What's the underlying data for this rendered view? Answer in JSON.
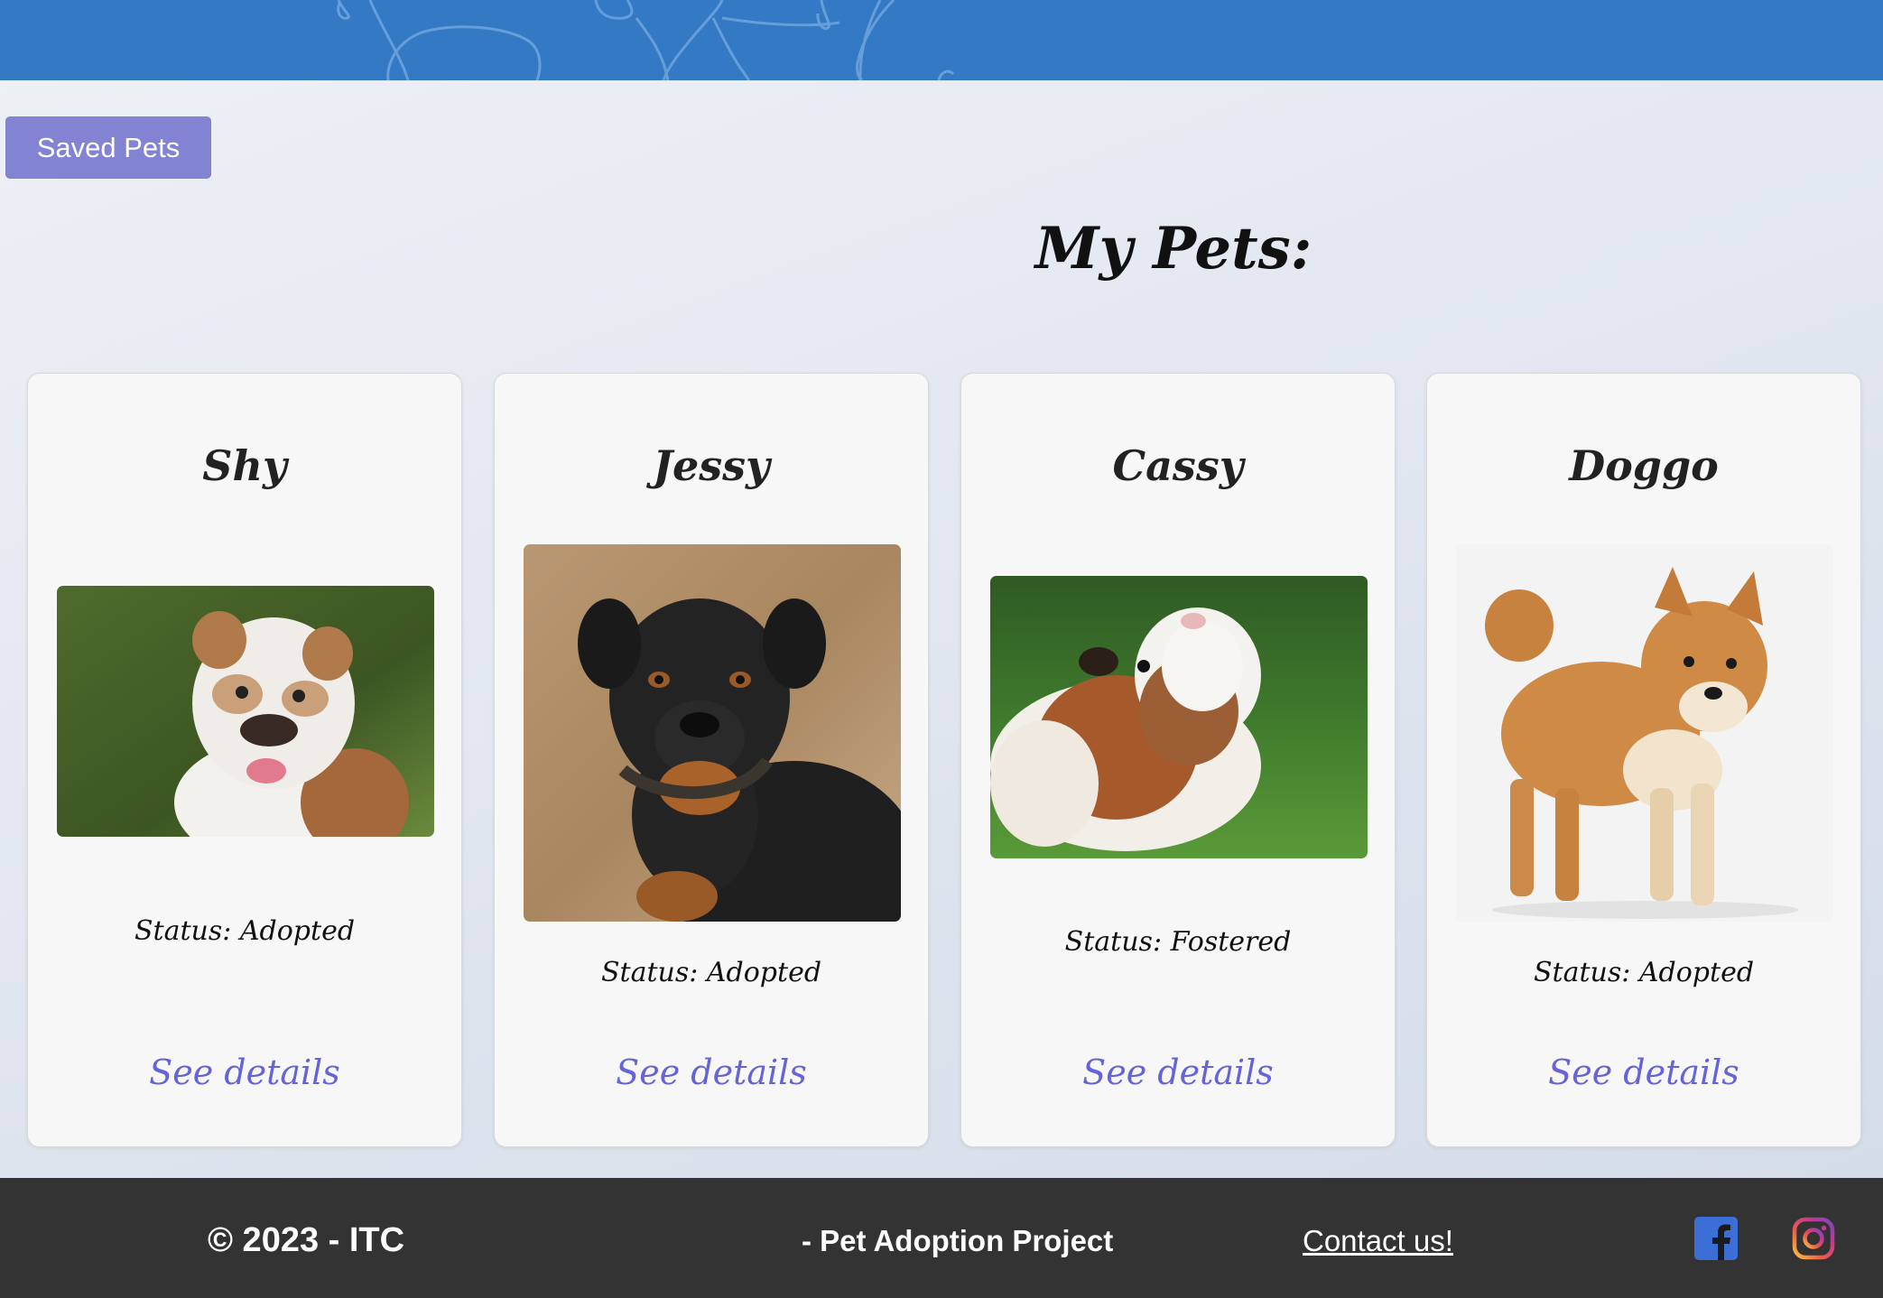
{
  "header": {
    "decoration": "line-art-dog-illustration"
  },
  "saved_pets_button": "Saved Pets",
  "page_title": "My Pets:",
  "pets": [
    {
      "name": "Shy",
      "status": "Status: Adopted",
      "link": "See details",
      "photo": "english-bulldog-photo"
    },
    {
      "name": "Jessy",
      "status": "Status: Adopted",
      "link": "See details",
      "photo": "rottweiler-photo"
    },
    {
      "name": "Cassy",
      "status": "Status: Fostered",
      "link": "See details",
      "photo": "guinea-pig-photo"
    },
    {
      "name": "Doggo",
      "status": "Status: Adopted",
      "link": "See details",
      "photo": "shiba-inu-photo"
    }
  ],
  "footer": {
    "copyright": "© 2023 - ITC",
    "project": "- Pet Adoption Project",
    "contact": "Contact us!",
    "icons": [
      "facebook-icon",
      "instagram-icon"
    ]
  },
  "colors": {
    "header": "#3479c3",
    "button": "#8383d4",
    "link": "#6464d8",
    "footer": "#333333",
    "facebook": "#3b6fd6"
  }
}
